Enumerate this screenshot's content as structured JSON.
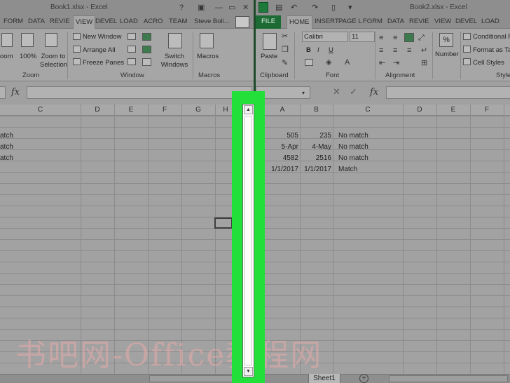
{
  "left_window": {
    "title": "Book1.xlsx - Excel",
    "tabs": [
      "FORM",
      "DATA",
      "REVIE",
      "VIEW",
      "DEVEL",
      "LOAD",
      "ACRO",
      "TEAM"
    ],
    "active_tab": "VIEW",
    "user": "Steve Boli...",
    "ribbon": {
      "zoom_label": "oom",
      "zoom100_label": "100%",
      "zoom_to_selection_label": "Zoom to Selection",
      "new_window": "New Window",
      "arrange_all": "Arrange All",
      "freeze_panes": "Freeze Panes",
      "switch_windows": "Switch Windows",
      "macros": "Macros",
      "group_zoom": "Zoom",
      "group_window": "Window",
      "group_macros": "Macros"
    },
    "fx": "fx",
    "columns": [
      "C",
      "D",
      "E",
      "F",
      "G",
      "H"
    ],
    "cells": [
      "atch",
      "atch",
      "atch"
    ],
    "sheet_tab": ""
  },
  "right_window": {
    "title": "Book2.xlsx - Excel",
    "tabs": [
      "FILE",
      "HOME",
      "INSERT",
      "PAGE L",
      "FORM",
      "DATA",
      "REVIE",
      "VIEW",
      "DEVEL",
      "LOAD"
    ],
    "active_tab": "HOME",
    "ribbon": {
      "paste": "Paste",
      "font_name": "Calibri",
      "font_size": "11",
      "bold": "B",
      "italic": "I",
      "underline": "U",
      "number": "Number",
      "percent": "%",
      "conditional_formatting": "Conditional Form",
      "format_as_table": "Format as Ta",
      "cell_styles": "Cell Styles",
      "group_clipboard": "Clipboard",
      "group_font": "Font",
      "group_alignment": "Alignment",
      "group_styles": "Style"
    },
    "fx": "fx",
    "columns": [
      "A",
      "B",
      "C",
      "D",
      "E",
      "F"
    ],
    "rows": [
      {
        "a": "505",
        "b": "235",
        "c": "No match"
      },
      {
        "a": "5-Apr",
        "b": "4-May",
        "c": "No match"
      },
      {
        "a": "4582",
        "b": "2516",
        "c": "No match"
      },
      {
        "a": "1/1/2017",
        "b": "1/1/2017",
        "c": "Match"
      }
    ],
    "sheet_tab": "Sheet1",
    "add_sheet": "+"
  },
  "scrollbar": {
    "up_icon": "▲",
    "down_icon": "▼",
    "highlight_color": "#22e039"
  },
  "watermark": "书吧网-Office教程网"
}
